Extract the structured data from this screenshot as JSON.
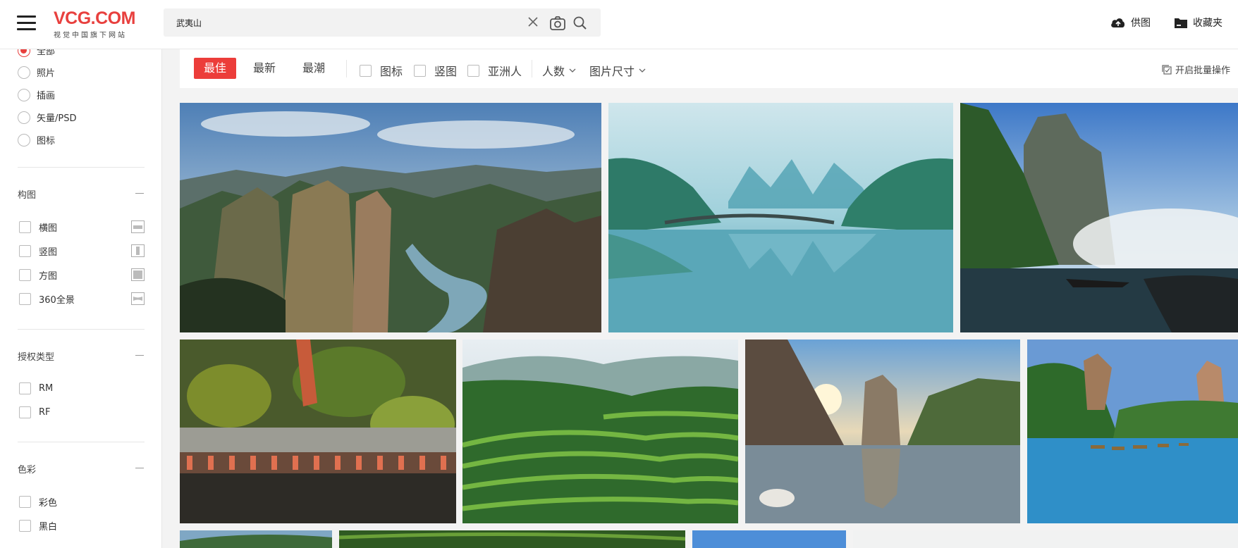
{
  "header": {
    "logo_text": "VCG.COM",
    "logo_subtitle": "视觉中国旗下网站",
    "search_value": "武夷山",
    "supply_label": "供图",
    "favorites_label": "收藏夹"
  },
  "sidebar": {
    "image_types": [
      {
        "label": "全部",
        "selected": true
      },
      {
        "label": "照片",
        "selected": false
      },
      {
        "label": "插画",
        "selected": false
      },
      {
        "label": "矢量/PSD",
        "selected": false
      },
      {
        "label": "图标",
        "selected": false
      }
    ],
    "composition": {
      "title": "构图",
      "items": [
        "横图",
        "竖图",
        "方图",
        "360全景"
      ]
    },
    "license": {
      "title": "授权类型",
      "items": [
        "RM",
        "RF"
      ]
    },
    "color": {
      "title": "色彩",
      "items": [
        "彩色",
        "黑白"
      ]
    }
  },
  "filterbar": {
    "tabs": [
      {
        "label": "最佳",
        "active": true
      },
      {
        "label": "最新",
        "active": false
      },
      {
        "label": "最潮",
        "active": false
      }
    ],
    "checks": [
      "图标",
      "竖图",
      "亚洲人"
    ],
    "dropdowns": [
      "人数",
      "图片尺寸"
    ],
    "batch_label": "开启批量操作"
  },
  "colors": {
    "accent": "#e8403e",
    "tab_active": "#ec3d3a"
  }
}
